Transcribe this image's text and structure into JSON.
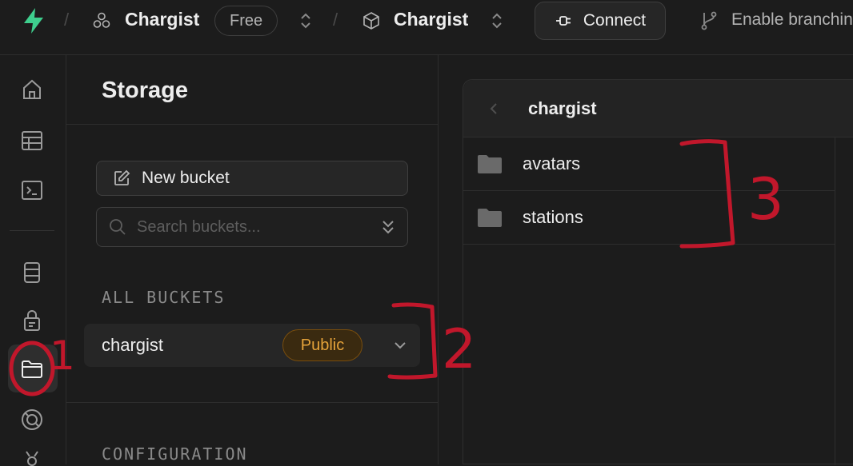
{
  "topbar": {
    "org_name": "Chargist",
    "plan_badge": "Free",
    "project_name": "Chargist",
    "connect_label": "Connect",
    "branching_label": "Enable branching"
  },
  "nav_icons": [
    "home-icon",
    "table-editor-icon",
    "sql-editor-icon",
    "database-icon",
    "auth-icon",
    "storage-icon",
    "realtime-icon",
    "settings-icon"
  ],
  "storage": {
    "title": "Storage",
    "new_bucket_label": "New bucket",
    "search_placeholder": "Search buckets...",
    "all_buckets_label": "ALL BUCKETS",
    "buckets": [
      {
        "name": "chargist",
        "badge": "Public"
      }
    ],
    "configuration_label": "CONFIGURATION"
  },
  "explorer": {
    "current_bucket": "chargist",
    "folders": [
      "avatars",
      "stations"
    ]
  },
  "annotations": [
    "1",
    "2",
    "3"
  ],
  "colors": {
    "brand": "#3ecf8e",
    "background": "#1c1c1c",
    "public_badge": "#e5a33a",
    "annotation_red": "#c1172b"
  }
}
